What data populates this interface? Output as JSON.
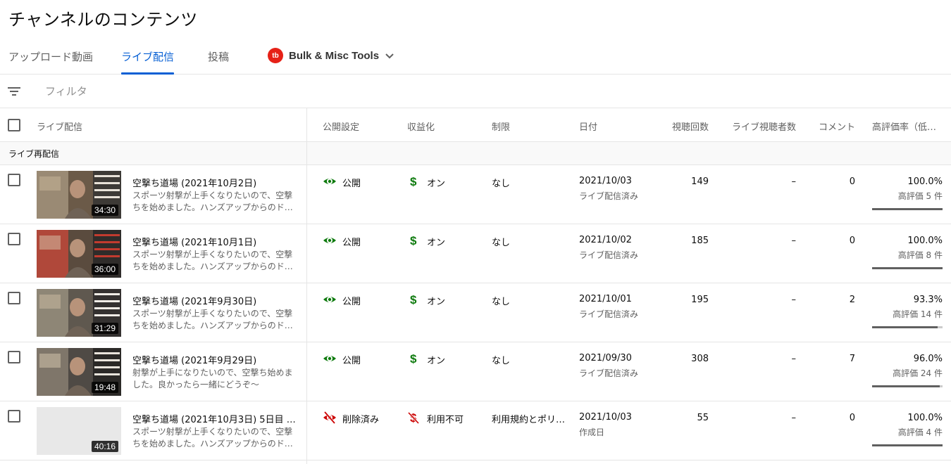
{
  "page": {
    "title": "チャンネルのコンテンツ"
  },
  "tabs": [
    {
      "label": "アップロード動画",
      "active": false
    },
    {
      "label": "ライブ配信",
      "active": true
    },
    {
      "label": "投稿",
      "active": false
    }
  ],
  "extension_tab": {
    "logo_text": "tb",
    "label": "Bulk & Misc Tools",
    "icon": "chevron-down-icon"
  },
  "filter": {
    "placeholder": "フィルタ",
    "icon": "filter-icon"
  },
  "columns": {
    "video": "ライブ配信",
    "visibility": "公開設定",
    "monetization": "収益化",
    "restrictions": "制限",
    "date": "日付",
    "views": "視聴回数",
    "live_viewers": "ライブ視聴者数",
    "comments": "コメント",
    "likes": "高評価率（低…"
  },
  "section": {
    "label": "ライブ再配信"
  },
  "rows": [
    {
      "title": "空撃ち道場 (2021年10月2日)",
      "description": "スポーツ射撃が上手くなりたいので、空撃ちを始めました。ハンズアップからのド…",
      "duration": "34:30",
      "visibility": "公開",
      "visibility_icon": "eye-icon",
      "monetization": "オン",
      "monetization_icon": "dollar-icon",
      "restrictions": "なし",
      "date": "2021/10/03",
      "date_status": "ライブ配信済み",
      "views": "149",
      "live_viewers": "–",
      "comments": "0",
      "like_ratio": "100.0%",
      "like_count": "高評価 5 件",
      "like_fraction": 1.0,
      "thumb_style": "a"
    },
    {
      "title": "空撃ち道場 (2021年10月1日)",
      "description": "スポーツ射撃が上手くなりたいので、空撃ちを始めました。ハンズアップからのド…",
      "duration": "36:00",
      "visibility": "公開",
      "visibility_icon": "eye-icon",
      "monetization": "オン",
      "monetization_icon": "dollar-icon",
      "restrictions": "なし",
      "date": "2021/10/02",
      "date_status": "ライブ配信済み",
      "views": "185",
      "live_viewers": "–",
      "comments": "0",
      "like_ratio": "100.0%",
      "like_count": "高評価 8 件",
      "like_fraction": 1.0,
      "thumb_style": "b"
    },
    {
      "title": "空撃ち道場 (2021年9月30日)",
      "description": "スポーツ射撃が上手くなりたいので、空撃ちを始めました。ハンズアップからのド…",
      "duration": "31:29",
      "visibility": "公開",
      "visibility_icon": "eye-icon",
      "monetization": "オン",
      "monetization_icon": "dollar-icon",
      "restrictions": "なし",
      "date": "2021/10/01",
      "date_status": "ライブ配信済み",
      "views": "195",
      "live_viewers": "–",
      "comments": "2",
      "like_ratio": "93.3%",
      "like_count": "高評価 14 件",
      "like_fraction": 0.933,
      "thumb_style": "c"
    },
    {
      "title": "空撃ち道場 (2021年9月29日)",
      "description": "射撃が上手になりたいので、空撃ち始めました。良かったら一緒にどうぞ〜",
      "duration": "19:48",
      "visibility": "公開",
      "visibility_icon": "eye-icon",
      "monetization": "オン",
      "monetization_icon": "dollar-icon",
      "restrictions": "なし",
      "date": "2021/09/30",
      "date_status": "ライブ配信済み",
      "views": "308",
      "live_viewers": "–",
      "comments": "7",
      "like_ratio": "96.0%",
      "like_count": "高評価 24 件",
      "like_fraction": 0.96,
      "thumb_style": "d"
    },
    {
      "title": "空撃ち道場 (2021年10月3日) 5日目 @…",
      "description": "スポーツ射撃が上手くなりたいので、空撃ちを始めました。ハンズアップからのド…",
      "duration": "40:16",
      "visibility": "削除済み",
      "visibility_icon": "eye-off-icon",
      "monetization": "利用不可",
      "monetization_icon": "dollar-off-icon",
      "restrictions": "利用規約とポリ…",
      "date": "2021/10/03",
      "date_status": "作成日",
      "views": "55",
      "live_viewers": "–",
      "comments": "0",
      "like_ratio": "100.0%",
      "like_count": "高評価 4 件",
      "like_fraction": 1.0,
      "thumb_style": "blank"
    }
  ],
  "colors": {
    "accent": "#065fd4",
    "public_green": "#0f7b0f",
    "removed_red": "#cc0000",
    "dollar_green": "#0f7b0f"
  }
}
